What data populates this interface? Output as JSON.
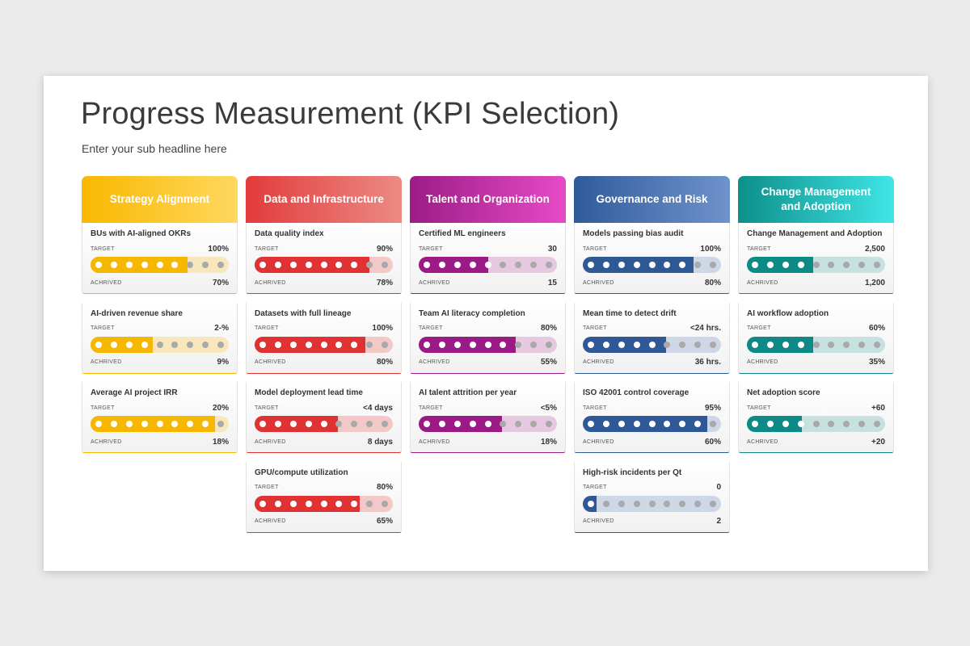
{
  "title": "Progress Measurement (KPI Selection)",
  "subtitle": "Enter your sub headline here",
  "labels": {
    "target": "TARGET",
    "achieved": "ACHRIVED"
  },
  "columns": [
    {
      "title": "Strategy Alignment",
      "gradient": [
        "#f9b800",
        "#ffd85e"
      ],
      "accent": "#f5b700",
      "track": "#f8e7bd",
      "kpis": [
        {
          "name": "BUs with AI-aligned OKRs",
          "target": "100%",
          "achieved": "70%",
          "progress": 0.7
        },
        {
          "name": "AI-driven revenue share",
          "target": "2-%",
          "achieved": "9%",
          "progress": 0.45
        },
        {
          "name": "Average AI project IRR",
          "target": "20%",
          "achieved": "18%",
          "progress": 0.9
        }
      ]
    },
    {
      "title": "Data and Infrastructure",
      "gradient": [
        "#e23b3b",
        "#ec8a84"
      ],
      "accent": "#e03232",
      "track": "#f2c9c6",
      "kpis": [
        {
          "name": "Data quality index",
          "target": "90%",
          "achieved": "78%",
          "progress": 0.83
        },
        {
          "name": "Datasets with full lineage",
          "target": "100%",
          "achieved": "80%",
          "progress": 0.8
        },
        {
          "name": "Model deployment lead time",
          "target": "<4 days",
          "achieved": "8 days",
          "progress": 0.6
        },
        {
          "name": "GPU/compute utilization",
          "target": "80%",
          "achieved": "65%",
          "progress": 0.76
        }
      ]
    },
    {
      "title": "Talent and Organization",
      "gradient": [
        "#9c1c86",
        "#e64bc6"
      ],
      "accent": "#9b1a85",
      "track": "#e6c9e0",
      "kpis": [
        {
          "name": "Certified ML engineers",
          "target": "30",
          "achieved": "15",
          "progress": 0.5
        },
        {
          "name": "Team AI literacy completion",
          "target": "80%",
          "achieved": "55%",
          "progress": 0.7
        },
        {
          "name": "AI talent attrition per year",
          "target": "<5%",
          "achieved": "18%",
          "progress": 0.6
        }
      ]
    },
    {
      "title": "Governance and Risk",
      "gradient": [
        "#2f5b9b",
        "#6f93cb"
      ],
      "accent": "#2e5896",
      "track": "#cdd7e6",
      "kpis": [
        {
          "name": "Models passing bias audit",
          "target": "100%",
          "achieved": "80%",
          "progress": 0.8
        },
        {
          "name": "Mean time to detect drift",
          "target": "<24 hrs.",
          "achieved": "36 hrs.",
          "progress": 0.6
        },
        {
          "name": "ISO 42001 control coverage",
          "target": "95%",
          "achieved": "60%",
          "progress": 0.9
        },
        {
          "name": "High-risk incidents per Qt",
          "target": "0",
          "achieved": "2",
          "progress": 0.1
        }
      ]
    },
    {
      "title": "Change Management and Adoption",
      "gradient": [
        "#0d8f8a",
        "#3fe6e6"
      ],
      "accent": "#0d8a86",
      "track": "#c6e1e0",
      "kpis": [
        {
          "name": "Change Management and Adoption",
          "target": "2,500",
          "achieved": "1,200",
          "progress": 0.48
        },
        {
          "name": "AI workflow adoption",
          "target": "60%",
          "achieved": "35%",
          "progress": 0.48
        },
        {
          "name": "Net adoption score",
          "target": "+60",
          "achieved": "+20",
          "progress": 0.4
        }
      ]
    }
  ]
}
